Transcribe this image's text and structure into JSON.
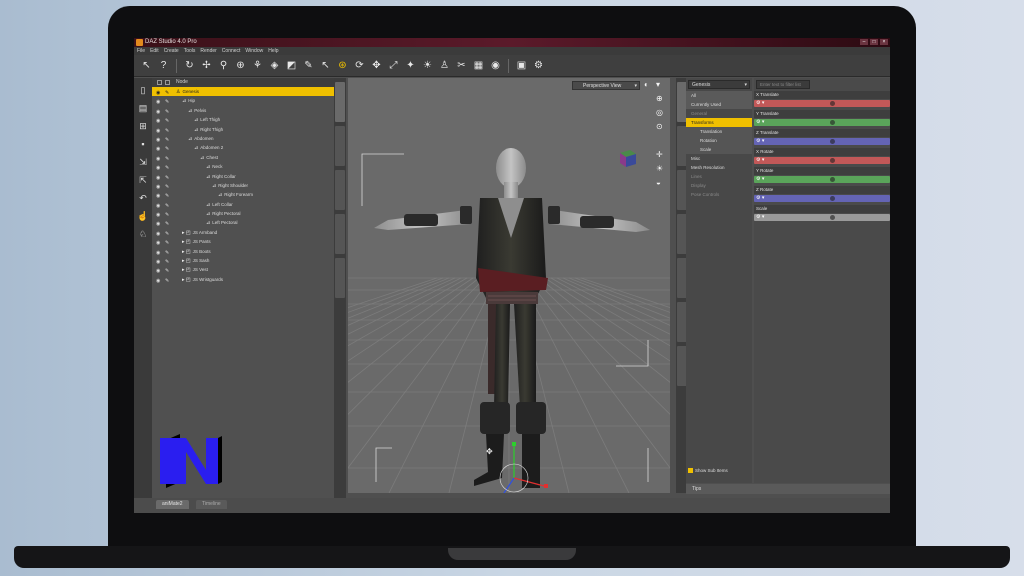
{
  "app": {
    "title": "DAZ Studio 4.0 Pro"
  },
  "menu": [
    "File",
    "Edit",
    "Create",
    "Tools",
    "Render",
    "Connect",
    "Window",
    "Help"
  ],
  "toolbar_icons": [
    "arrow-tool-icon",
    "help-icon",
    "rotate-tool-icon",
    "pose-tool-icon",
    "joint-tool-icon",
    "node-tool-icon",
    "region-tool-icon",
    "surface-tool-icon",
    "geometry-tool-icon",
    "ruler-tool-icon",
    "select-tool-icon",
    "universal-tool-icon",
    "rotate-icon",
    "translate-icon",
    "scale-icon",
    "spot-render-icon",
    "light-icon",
    "figure-icon",
    "morph-icon",
    "texture-icon",
    "camera-icon",
    "render-icon",
    "settings-icon"
  ],
  "scene": {
    "header": "Node",
    "nodes": [
      {
        "label": "Genesis",
        "depth": 0,
        "selected": true
      },
      {
        "label": "Hip",
        "depth": 1
      },
      {
        "label": "Pelvis",
        "depth": 2
      },
      {
        "label": "Left Thigh",
        "depth": 3
      },
      {
        "label": "Right Thigh",
        "depth": 3
      },
      {
        "label": "Abdomen",
        "depth": 2
      },
      {
        "label": "Abdomen 2",
        "depth": 3
      },
      {
        "label": "Chest",
        "depth": 4
      },
      {
        "label": "Neck",
        "depth": 5
      },
      {
        "label": "Right Collar",
        "depth": 5
      },
      {
        "label": "Right Shoulder",
        "depth": 6
      },
      {
        "label": "Right Forearm",
        "depth": 7
      },
      {
        "label": "Left Collar",
        "depth": 5
      },
      {
        "label": "Right Pectoral",
        "depth": 5
      },
      {
        "label": "Left Pectoral",
        "depth": 5
      },
      {
        "label": "JS Armband",
        "depth": 1
      },
      {
        "label": "JS Pants",
        "depth": 1
      },
      {
        "label": "JS Boots",
        "depth": 1
      },
      {
        "label": "JS Sash",
        "depth": 1
      },
      {
        "label": "JS Vest",
        "depth": 1
      },
      {
        "label": "JS Wristguards",
        "depth": 1
      }
    ]
  },
  "viewport": {
    "view_label": "Perspective View"
  },
  "parameters": {
    "node_dropdown": "Genesis",
    "filter_placeholder": "Enter text to filter list",
    "nav": [
      {
        "label": "All",
        "kind": "hd"
      },
      {
        "label": "Currently Used",
        "kind": "hd"
      },
      {
        "label": "General",
        "kind": "dim"
      },
      {
        "label": "Transforms",
        "kind": "sel"
      },
      {
        "label": "Translation",
        "kind": "sub"
      },
      {
        "label": "Rotation",
        "kind": "sub"
      },
      {
        "label": "Scale",
        "kind": "sub"
      },
      {
        "label": "Misc",
        "kind": "plain"
      },
      {
        "label": "Mesh Resolution",
        "kind": "plain"
      },
      {
        "label": "Lines",
        "kind": "dim"
      },
      {
        "label": "Display",
        "kind": "dim"
      },
      {
        "label": "Pose Controls",
        "kind": "dim"
      }
    ],
    "properties": [
      {
        "label": "X Translate",
        "color": "#c25858"
      },
      {
        "label": "Y Translate",
        "color": "#5aa45a"
      },
      {
        "label": "Z Translate",
        "color": "#6464b4"
      },
      {
        "label": "X Rotate",
        "color": "#c25858"
      },
      {
        "label": "Y Rotate",
        "color": "#5aa45a"
      },
      {
        "label": "Z Rotate",
        "color": "#6464b4"
      },
      {
        "label": "Scale",
        "color": "#9a9a9a"
      }
    ],
    "show_sub_items": "Show Sub Items",
    "tips_tab": "Tips"
  },
  "bottom_tabs": [
    "aniMate2",
    "Timeline"
  ],
  "colors": {
    "accent": "#f0c000",
    "panel": "#505050",
    "viewport": "#6a6a6a",
    "logo": "#2a1ef0"
  }
}
